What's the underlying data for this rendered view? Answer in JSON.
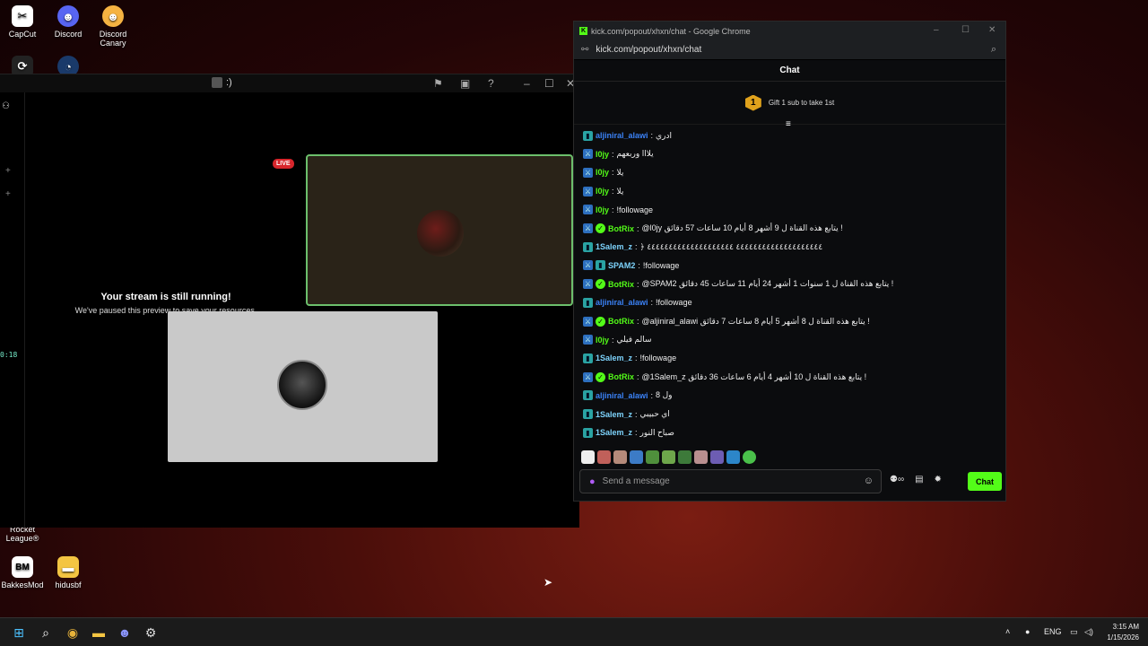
{
  "desktop": {
    "icons": [
      {
        "label": "CapCut"
      },
      {
        "label": "Discord"
      },
      {
        "label": "Discord Canary"
      },
      {
        "label": "Rocket League®"
      },
      {
        "label": "BakkesMod"
      },
      {
        "label": "hidusbf"
      }
    ]
  },
  "stream_window": {
    "title": ":)",
    "live_badge": "LIVE",
    "running_title": "Your stream is still running!",
    "running_sub": "We've paused this preview to save your resources.",
    "side_code": "0:18"
  },
  "chrome": {
    "title": "kick.com/popout/xhxn/chat - Google Chrome",
    "url": "kick.com/popout/xhxn/chat"
  },
  "chat": {
    "header": "Chat",
    "gift_badge": "1",
    "gift_text": "Gift 1 sub to take 1st",
    "messages": [
      {
        "user": "aljiniral_alawi",
        "color": "#3b82f6",
        "badges": [
          "sub"
        ],
        "text": "ادري"
      },
      {
        "user": "l0jy",
        "color": "#53fc18",
        "badges": [
          "mod"
        ],
        "text": "يلااا وربعهم"
      },
      {
        "user": "l0jy",
        "color": "#53fc18",
        "badges": [
          "mod"
        ],
        "text": "يلا"
      },
      {
        "user": "l0jy",
        "color": "#53fc18",
        "badges": [
          "mod"
        ],
        "text": "يلا"
      },
      {
        "user": "l0jy",
        "color": "#53fc18",
        "badges": [
          "mod"
        ],
        "text": "!followage"
      },
      {
        "user": "BotRix",
        "color": "#53fc18",
        "badges": [
          "mod",
          "ver"
        ],
        "text": "@l0jy يتابع هذه القناة ل 9 أشهر 8 أيام 10 ساعات 57 دقائق !"
      },
      {
        "user": "1Salem_z",
        "color": "#7dd3fc",
        "badges": [
          "sub"
        ],
        "text": "﴿ ٤٤٤٤٤٤٤٤٤٤٤٤٤٤٤٤٤٤٤٤ ٤٤٤٤٤٤٤٤٤٤٤٤٤٤٤٤٤٤٤٤"
      },
      {
        "user": "SPAM2",
        "color": "#7dd3fc",
        "badges": [
          "mod",
          "sub"
        ],
        "text": "!followage"
      },
      {
        "user": "BotRix",
        "color": "#53fc18",
        "badges": [
          "mod",
          "ver"
        ],
        "text": "@SPAM2 يتابع هذه القناة ل 1 سنوات 1 أشهر 24 أيام 11 ساعات 45 دقائق !"
      },
      {
        "user": "aljiniral_alawi",
        "color": "#3b82f6",
        "badges": [
          "sub"
        ],
        "text": "!followage"
      },
      {
        "user": "BotRix",
        "color": "#53fc18",
        "badges": [
          "mod",
          "ver"
        ],
        "text": "@aljiniral_alawi يتابع هذه القناة ل 8 أشهر 5 أيام 8 ساعات 7 دقائق !"
      },
      {
        "user": "l0jy",
        "color": "#53fc18",
        "badges": [
          "mod"
        ],
        "text": "سالم فيلي"
      },
      {
        "user": "1Salem_z",
        "color": "#7dd3fc",
        "badges": [
          "sub"
        ],
        "text": "!followage"
      },
      {
        "user": "BotRix",
        "color": "#53fc18",
        "badges": [
          "mod",
          "ver"
        ],
        "text": "@1Salem_z يتابع هذه القناة ل 10 أشهر 4 أيام 6 ساعات 36 دقائق !"
      },
      {
        "user": "aljiniral_alawi",
        "color": "#3b82f6",
        "badges": [
          "sub"
        ],
        "text": "ول 8"
      },
      {
        "user": "1Salem_z",
        "color": "#7dd3fc",
        "badges": [
          "sub"
        ],
        "text": "اي حبيبي"
      },
      {
        "user": "1Salem_z",
        "color": "#7dd3fc",
        "badges": [
          "sub"
        ],
        "text": "صباح النور"
      }
    ],
    "input_placeholder": "Send a message",
    "send_label": "Chat"
  },
  "taskbar": {
    "lang": "ENG",
    "time": "3:15 AM",
    "date": "1/15/2026"
  }
}
